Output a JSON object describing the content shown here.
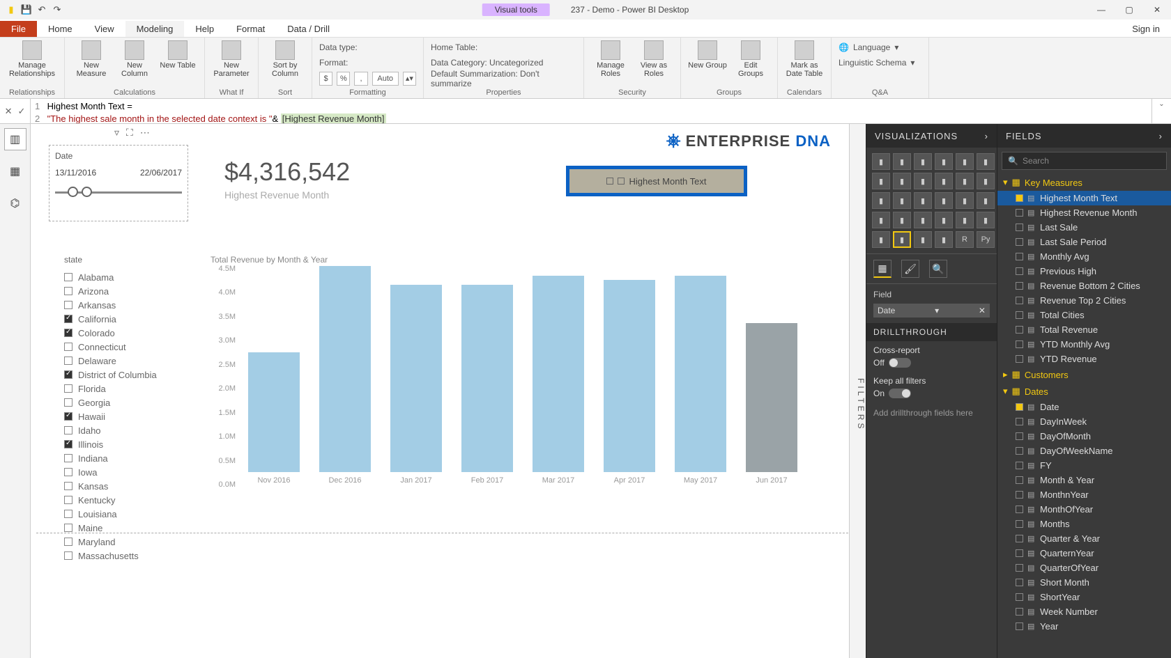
{
  "titlebar": {
    "visual_tools": "Visual tools",
    "title": "237 - Demo - Power BI Desktop"
  },
  "menu": {
    "file": "File",
    "tabs": [
      "Home",
      "View",
      "Modeling",
      "Help",
      "Format",
      "Data / Drill"
    ],
    "active": "Modeling",
    "signin": "Sign in"
  },
  "ribbon": {
    "relationships": {
      "manage": "Manage\nRelationships",
      "group": "Relationships"
    },
    "calculations": {
      "measure": "New\nMeasure",
      "column": "New\nColumn",
      "table": "New\nTable",
      "group": "Calculations"
    },
    "whatif": {
      "param": "New\nParameter",
      "group": "What If"
    },
    "sort": {
      "sortby": "Sort by\nColumn",
      "group": "Sort"
    },
    "formatting": {
      "datatype": "Data type:",
      "format": "Format:",
      "auto": "Auto",
      "group": "Formatting"
    },
    "properties": {
      "hometable": "Home Table:",
      "datacategory": "Data Category: Uncategorized",
      "summarization": "Default Summarization: Don't summarize",
      "group": "Properties"
    },
    "security": {
      "manage": "Manage\nRoles",
      "viewas": "View as\nRoles",
      "group": "Security"
    },
    "groups": {
      "new": "New\nGroup",
      "edit": "Edit\nGroups",
      "group": "Groups"
    },
    "calendars": {
      "mark": "Mark as\nDate Table",
      "group": "Calendars"
    },
    "qa": {
      "lang": "Language",
      "schema": "Linguistic Schema",
      "group": "Q&A"
    }
  },
  "formula": {
    "line1": "Highest Month Text =",
    "line2_a": "\"The highest sale month in the selected date context is \"",
    "line2_b": "& ",
    "line2_c": "[Highest Revenue Month]"
  },
  "canvas": {
    "logo_a": "ENTERPRISE",
    "logo_b": "DNA",
    "slicer": {
      "title": "Date",
      "from": "13/11/2016",
      "to": "22/06/2017"
    },
    "kpi": {
      "value": "$4,316,542",
      "label": "Highest Revenue Month"
    },
    "sel_placeholder": "Highest Month Text",
    "state": {
      "header": "state",
      "items": [
        {
          "label": "Alabama",
          "checked": false
        },
        {
          "label": "Arizona",
          "checked": false
        },
        {
          "label": "Arkansas",
          "checked": false
        },
        {
          "label": "California",
          "checked": true
        },
        {
          "label": "Colorado",
          "checked": true
        },
        {
          "label": "Connecticut",
          "checked": false
        },
        {
          "label": "Delaware",
          "checked": false
        },
        {
          "label": "District of Columbia",
          "checked": true
        },
        {
          "label": "Florida",
          "checked": false
        },
        {
          "label": "Georgia",
          "checked": false
        },
        {
          "label": "Hawaii",
          "checked": true
        },
        {
          "label": "Idaho",
          "checked": false
        },
        {
          "label": "Illinois",
          "checked": true
        },
        {
          "label": "Indiana",
          "checked": false
        },
        {
          "label": "Iowa",
          "checked": false
        },
        {
          "label": "Kansas",
          "checked": false
        },
        {
          "label": "Kentucky",
          "checked": false
        },
        {
          "label": "Louisiana",
          "checked": false
        },
        {
          "label": "Maine",
          "checked": false
        },
        {
          "label": "Maryland",
          "checked": false
        },
        {
          "label": "Massachusetts",
          "checked": false
        }
      ]
    }
  },
  "chart_data": {
    "type": "bar",
    "title": "Total Revenue by Month & Year",
    "ylabel": "",
    "xlabel": "",
    "ylim": [
      0,
      4.5
    ],
    "yticks": [
      "4.5M",
      "4.0M",
      "3.5M",
      "3.0M",
      "2.5M",
      "2.0M",
      "1.5M",
      "1.0M",
      "0.5M",
      "0.0M"
    ],
    "categories": [
      "Nov 2016",
      "Dec 2016",
      "Jan 2017",
      "Feb 2017",
      "Mar 2017",
      "Apr 2017",
      "May 2017",
      "Jun 2017"
    ],
    "values": [
      2.5,
      4.3,
      3.9,
      3.9,
      4.1,
      4.0,
      4.1,
      3.1
    ],
    "highlight_index": 7
  },
  "viz": {
    "header": "VISUALIZATIONS",
    "field_label": "Field",
    "field_value": "Date",
    "drill_header": "DRILLTHROUGH",
    "cross": "Cross-report",
    "cross_state": "Off",
    "keep": "Keep all filters",
    "keep_state": "On",
    "add": "Add drillthrough fields here"
  },
  "fields": {
    "header": "FIELDS",
    "search": "Search",
    "groups": [
      {
        "name": "Key Measures",
        "expanded": true,
        "items": [
          {
            "name": "Highest Month Text",
            "checked": true,
            "selected": true
          },
          {
            "name": "Highest Revenue Month",
            "checked": false
          },
          {
            "name": "Last Sale",
            "checked": false
          },
          {
            "name": "Last Sale Period",
            "checked": false
          },
          {
            "name": "Monthly Avg",
            "checked": false
          },
          {
            "name": "Previous High",
            "checked": false
          },
          {
            "name": "Revenue Bottom 2 Cities",
            "checked": false
          },
          {
            "name": "Revenue Top 2 Cities",
            "checked": false
          },
          {
            "name": "Total Cities",
            "checked": false
          },
          {
            "name": "Total Revenue",
            "checked": false
          },
          {
            "name": "YTD Monthly Avg",
            "checked": false
          },
          {
            "name": "YTD Revenue",
            "checked": false
          }
        ]
      },
      {
        "name": "Customers",
        "expanded": false,
        "items": []
      },
      {
        "name": "Dates",
        "expanded": true,
        "items": [
          {
            "name": "Date",
            "checked": true
          },
          {
            "name": "DayInWeek",
            "checked": false
          },
          {
            "name": "DayOfMonth",
            "checked": false
          },
          {
            "name": "DayOfWeekName",
            "checked": false
          },
          {
            "name": "FY",
            "checked": false
          },
          {
            "name": "Month & Year",
            "checked": false
          },
          {
            "name": "MonthnYear",
            "checked": false
          },
          {
            "name": "MonthOfYear",
            "checked": false
          },
          {
            "name": "Months",
            "checked": false
          },
          {
            "name": "Quarter & Year",
            "checked": false
          },
          {
            "name": "QuarternYear",
            "checked": false
          },
          {
            "name": "QuarterOfYear",
            "checked": false
          },
          {
            "name": "Short Month",
            "checked": false
          },
          {
            "name": "ShortYear",
            "checked": false
          },
          {
            "name": "Week Number",
            "checked": false
          },
          {
            "name": "Year",
            "checked": false
          }
        ]
      }
    ]
  },
  "filters_tab": "FILTERS"
}
